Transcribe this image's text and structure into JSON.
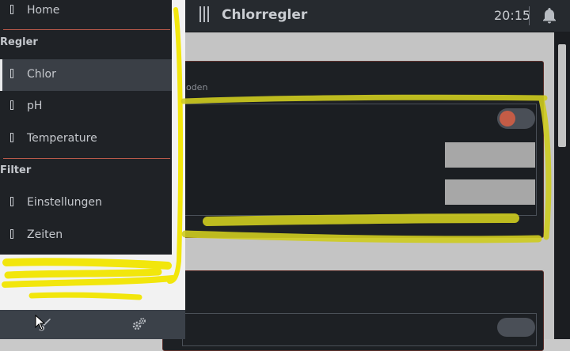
{
  "header": {
    "title": "Chlorregler",
    "time": "20:15"
  },
  "content": {
    "card1_label": "noden"
  },
  "drawer": {
    "home_label": "Home",
    "section_regler": "Regler",
    "section_filter": "Filter",
    "items": [
      {
        "label": "Chlor"
      },
      {
        "label": "pH"
      },
      {
        "label": "Temperature"
      },
      {
        "label": "Einstellungen"
      },
      {
        "label": "Zeiten"
      }
    ]
  },
  "colors": {
    "accent": "#c45c46",
    "divider": "#b8594a",
    "highlight": "#f2e600"
  },
  "icons": [
    "menu-icon",
    "bell-icon",
    "brush-icon",
    "gears-icon",
    "cursor-icon"
  ]
}
